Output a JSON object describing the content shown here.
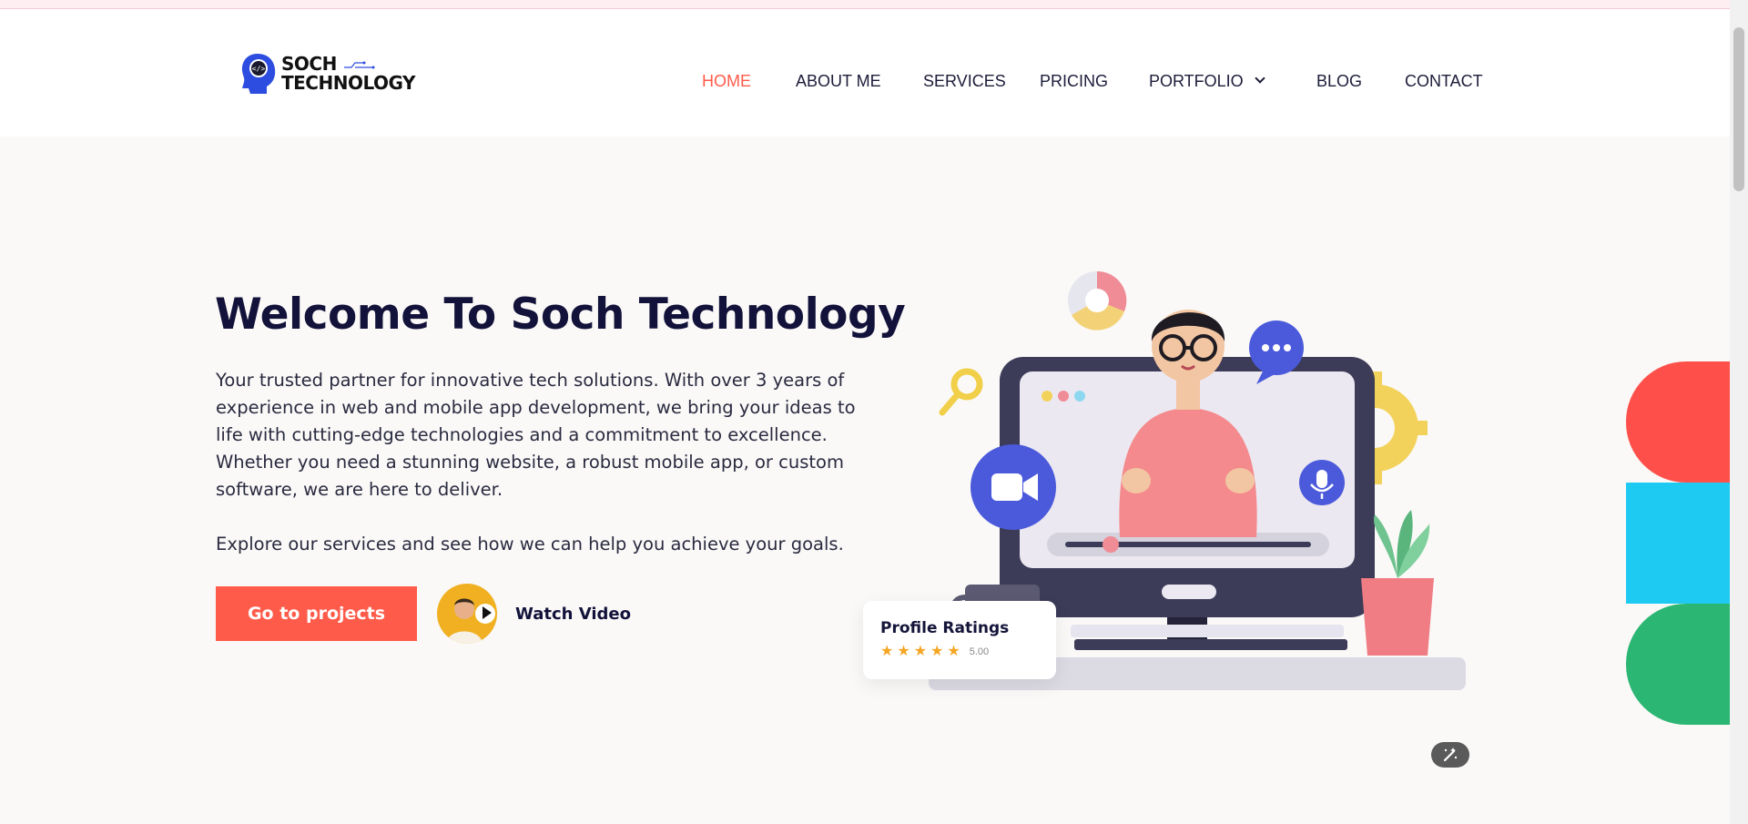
{
  "logo": {
    "line1": "SOCH",
    "line2": "TECHNOLOGY"
  },
  "nav": {
    "items": [
      {
        "label": "HOME",
        "active": true
      },
      {
        "label": "ABOUT ME"
      },
      {
        "label": "SERVICES"
      },
      {
        "label": "PRICING"
      },
      {
        "label": "PORTFOLIO",
        "has_dropdown": true
      },
      {
        "label": "BLOG"
      },
      {
        "label": "CONTACT"
      }
    ]
  },
  "hero": {
    "title": "Welcome To Soch Technology",
    "paragraph": "Your trusted partner for innovative tech solutions. With over 3 years of experience in web and mobile app development, we bring your ideas to life with cutting-edge technologies and a commitment to excellence. Whether you need a stunning website, a robust mobile app, or custom software, we are here to deliver.",
    "paragraph2": "Explore our services and see how we can help you achieve your goals.",
    "cta_label": "Go to projects",
    "watch_label": "Watch Video"
  },
  "rating_card": {
    "title": "Profile Ratings",
    "value": "5.00",
    "stars": 5
  },
  "colors": {
    "accent": "#ff5b4a",
    "navy": "#12123a",
    "cyan": "#1fcaf2",
    "green": "#2bb673",
    "star": "#f5a623"
  }
}
